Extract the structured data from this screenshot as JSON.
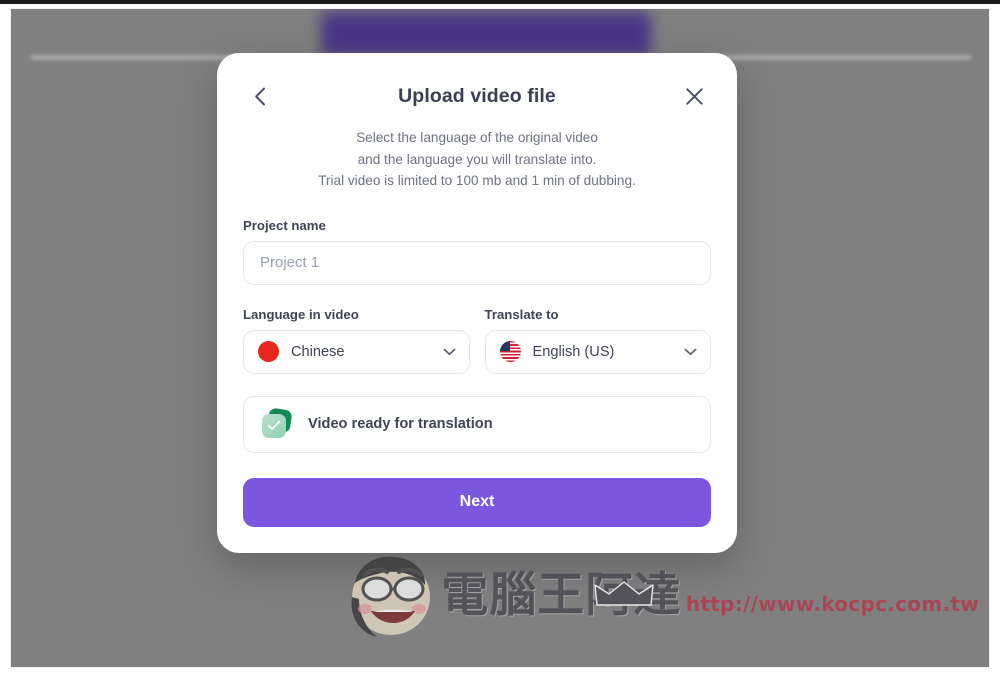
{
  "modal": {
    "title": "Upload video file",
    "back_icon": "chevron-left-icon",
    "close_icon": "close-icon",
    "subtitle_lines": [
      "Select the language of the original video",
      "and the language you will translate into.",
      "Trial video is limited to 100 mb and 1 min of dubbing."
    ],
    "project": {
      "label": "Project name",
      "value": "",
      "placeholder": "Project 1"
    },
    "source_language": {
      "label": "Language in video",
      "value": "Chinese",
      "flag": "flag-china-icon",
      "chevron": "chevron-down-icon"
    },
    "target_language": {
      "label": "Translate to",
      "value": "English (US)",
      "flag": "flag-us-icon",
      "chevron": "chevron-down-icon"
    },
    "status": {
      "text": "Video ready for translation",
      "icon": "video-ready-check-icon"
    },
    "next_button": "Next"
  },
  "watermark": {
    "brand": "電腦王阿達",
    "url": "http://www.kocpc.com.tw"
  },
  "colors": {
    "primary": "#7d56df",
    "overlay": "#808080",
    "banner": "#463287",
    "title_text": "#3a3f52",
    "subtitle_text": "#6f7382",
    "border": "#e4e7ec",
    "status_green": "#0f8a52",
    "flag_red": "#e8261c",
    "watermark_url": "#b23a4a"
  }
}
